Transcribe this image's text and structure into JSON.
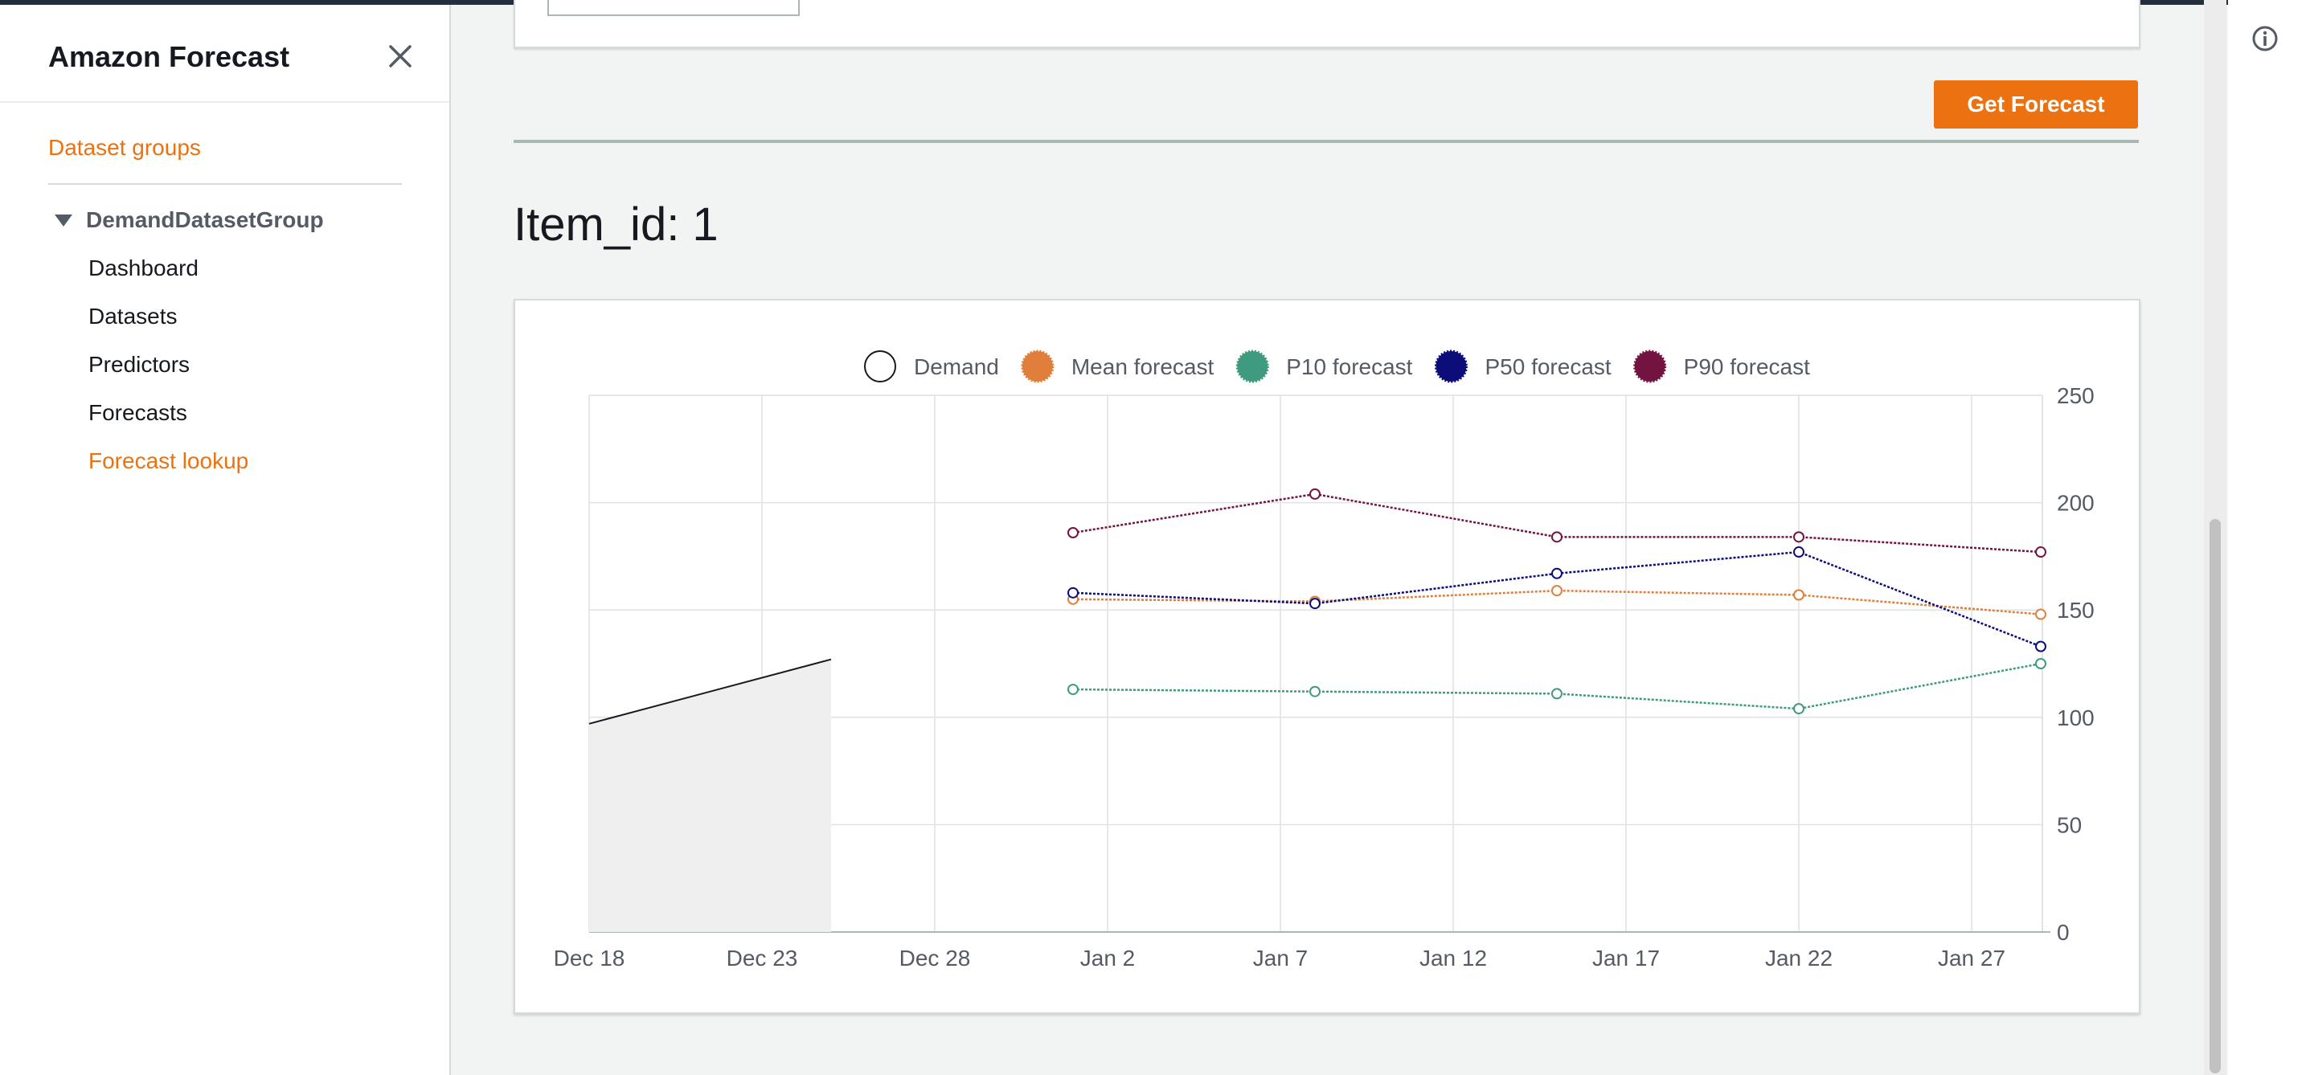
{
  "sidebar": {
    "title": "Amazon Forecast",
    "close_icon": "close-icon",
    "dataset_groups_link": "Dataset groups",
    "group_name": "DemandDatasetGroup",
    "items": [
      {
        "label": "Dashboard",
        "active": false
      },
      {
        "label": "Datasets",
        "active": false
      },
      {
        "label": "Predictors",
        "active": false
      },
      {
        "label": "Forecasts",
        "active": false
      },
      {
        "label": "Forecast lookup",
        "active": true
      }
    ]
  },
  "main": {
    "get_forecast_button": "Get Forecast",
    "heading": "Item_id: 1"
  },
  "right_rail": {
    "info_icon": "info-icon"
  },
  "colors": {
    "accent": "#ec7211",
    "demand": "#16191f",
    "mean": "#e07f3b",
    "p10": "#3f9b7f",
    "p50": "#0d0d7a",
    "p90": "#721340"
  },
  "chart_data": {
    "type": "line",
    "x_ticks": [
      "Dec 18",
      "Dec 23",
      "Dec 28",
      "Jan 2",
      "Jan 7",
      "Jan 12",
      "Jan 17",
      "Jan 22",
      "Jan 27"
    ],
    "y_ticks": [
      "0",
      "50",
      "100",
      "150",
      "200",
      "250"
    ],
    "ylim": [
      0,
      250
    ],
    "y_axis_side": "right",
    "grid": true,
    "legend_position": "top",
    "demand_area": {
      "name": "Demand",
      "x": [
        "Dec 18",
        "Dec 25"
      ],
      "y": [
        97,
        127
      ]
    },
    "x_dates": [
      "Jan 1",
      "Jan 8",
      "Jan 15",
      "Jan 22",
      "Jan 29"
    ],
    "series": [
      {
        "name": "Mean forecast",
        "color": "#e07f3b",
        "values": [
          155,
          154,
          159,
          157,
          148
        ]
      },
      {
        "name": "P10 forecast",
        "color": "#3f9b7f",
        "values": [
          113,
          112,
          111,
          104,
          125
        ]
      },
      {
        "name": "P50 forecast",
        "color": "#0d0d7a",
        "values": [
          158,
          153,
          167,
          177,
          133
        ]
      },
      {
        "name": "P90 forecast",
        "color": "#721340",
        "values": [
          186,
          204,
          184,
          184,
          177
        ]
      }
    ]
  }
}
